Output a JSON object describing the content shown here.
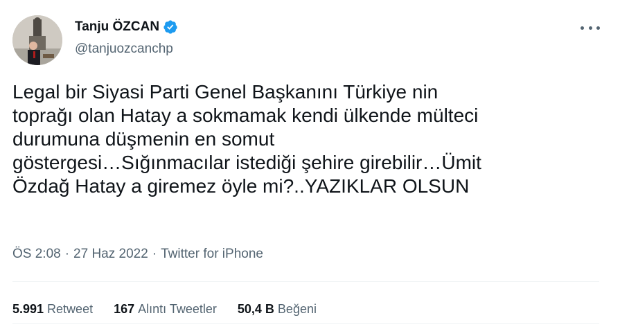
{
  "author": {
    "display_name": "Tanju ÖZCAN",
    "handle": "@tanjuozcanchp",
    "verified": true,
    "avatar_icon": "profile-photo"
  },
  "tweet": {
    "text": "Legal bir Siyasi Parti Genel Başkanını Türkiye nin\ntoprağı olan Hatay a sokmamak kendi ülkende mülteci\ndurumuna düşmenin en somut\ngöstergesi…Sığınmacılar istediği şehire girebilir…Ümit\nÖzdağ Hatay a giremez öyle mi?..YAZIKLAR OLSUN",
    "time": "ÖS 2:08",
    "date": "27 Haz 2022",
    "source": "Twitter for iPhone",
    "separator": "·"
  },
  "stats": {
    "retweets_count": "5.991",
    "retweets_label": "Retweet",
    "quotes_count": "167",
    "quotes_label": "Alıntı Tweetler",
    "likes_count": "50,4 B",
    "likes_label": "Beğeni"
  },
  "colors": {
    "text": "#0f1419",
    "secondary": "#536471",
    "verified_badge": "#1d9bf0",
    "divider": "#eff3f4"
  }
}
